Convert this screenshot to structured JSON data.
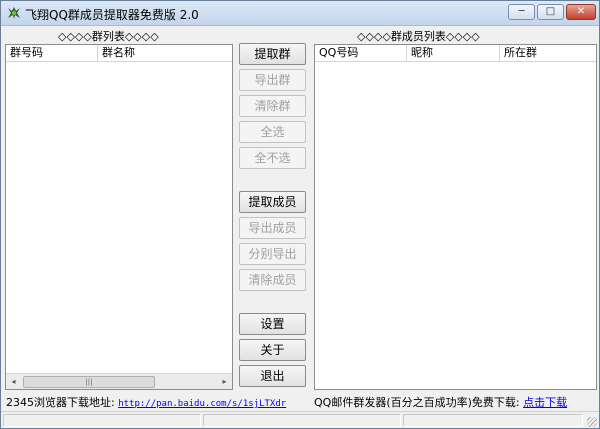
{
  "window": {
    "title": "飞翔QQ群成员提取器免费版 2.0",
    "minimize": "─",
    "maximize": "□",
    "close": "✕"
  },
  "left_panel": {
    "label": "◇◇◇◇群列表◇◇◇◇",
    "columns": [
      "群号码",
      "群名称"
    ],
    "rows": []
  },
  "right_panel": {
    "label": "◇◇◇◇群成员列表◇◇◇◇",
    "columns": [
      "QQ号码",
      "昵称",
      "所在群"
    ],
    "rows": []
  },
  "scrollbar": {
    "left_arrow": "◂",
    "right_arrow": "▸",
    "thumb_grip": "|||"
  },
  "buttons": {
    "extract_groups": "提取群",
    "export_groups": "导出群",
    "clear_groups": "清除群",
    "select_all": "全选",
    "select_none": "全不选",
    "extract_members": "提取成员",
    "export_members": "导出成员",
    "export_separately": "分别导出",
    "clear_members": "清除成员",
    "settings": "设置",
    "about": "关于",
    "exit": "退出"
  },
  "footer": {
    "browser_label": "2345浏览器下载地址:",
    "browser_link": "http://pan.baidu.com/s/1sjLTXdr",
    "mailer_label": "QQ邮件群发器(百分之百成功率)免费下载:",
    "mailer_link": "点击下载"
  },
  "colors": {
    "link": "#0000ff",
    "disabled_text": "#a0a0a0",
    "window_bg": "#f0f0f0"
  }
}
